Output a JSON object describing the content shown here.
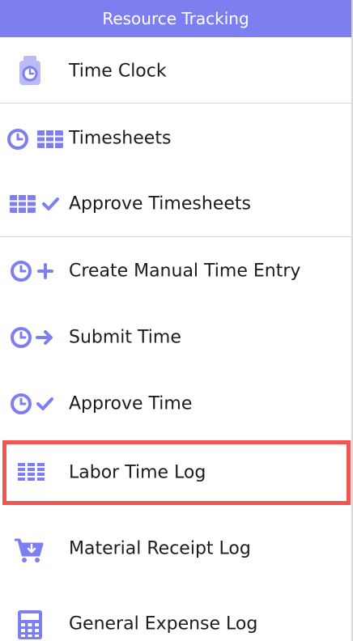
{
  "menu": {
    "header": "Resource Tracking",
    "items": [
      {
        "label": "Time Clock",
        "icon": "time-clock-icon"
      },
      {
        "label": "Timesheets",
        "icon": "clock-grid-icon"
      },
      {
        "label": "Approve Timesheets",
        "icon": "grid-check-icon"
      },
      {
        "label": "Create Manual Time Entry",
        "icon": "clock-plus-icon"
      },
      {
        "label": "Submit Time",
        "icon": "clock-arrow-icon"
      },
      {
        "label": "Approve Time",
        "icon": "clock-check-icon"
      },
      {
        "label": "Labor Time Log",
        "icon": "labor-log-icon",
        "selected": true
      },
      {
        "label": "Material Receipt Log",
        "icon": "cart-download-icon"
      },
      {
        "label": "General Expense Log",
        "icon": "calculator-icon"
      }
    ]
  },
  "colors": {
    "accent": "#7d7ff0",
    "icon": "#7d7ff0",
    "highlight_border": "#f2564e",
    "text": "#1c1c1c"
  }
}
